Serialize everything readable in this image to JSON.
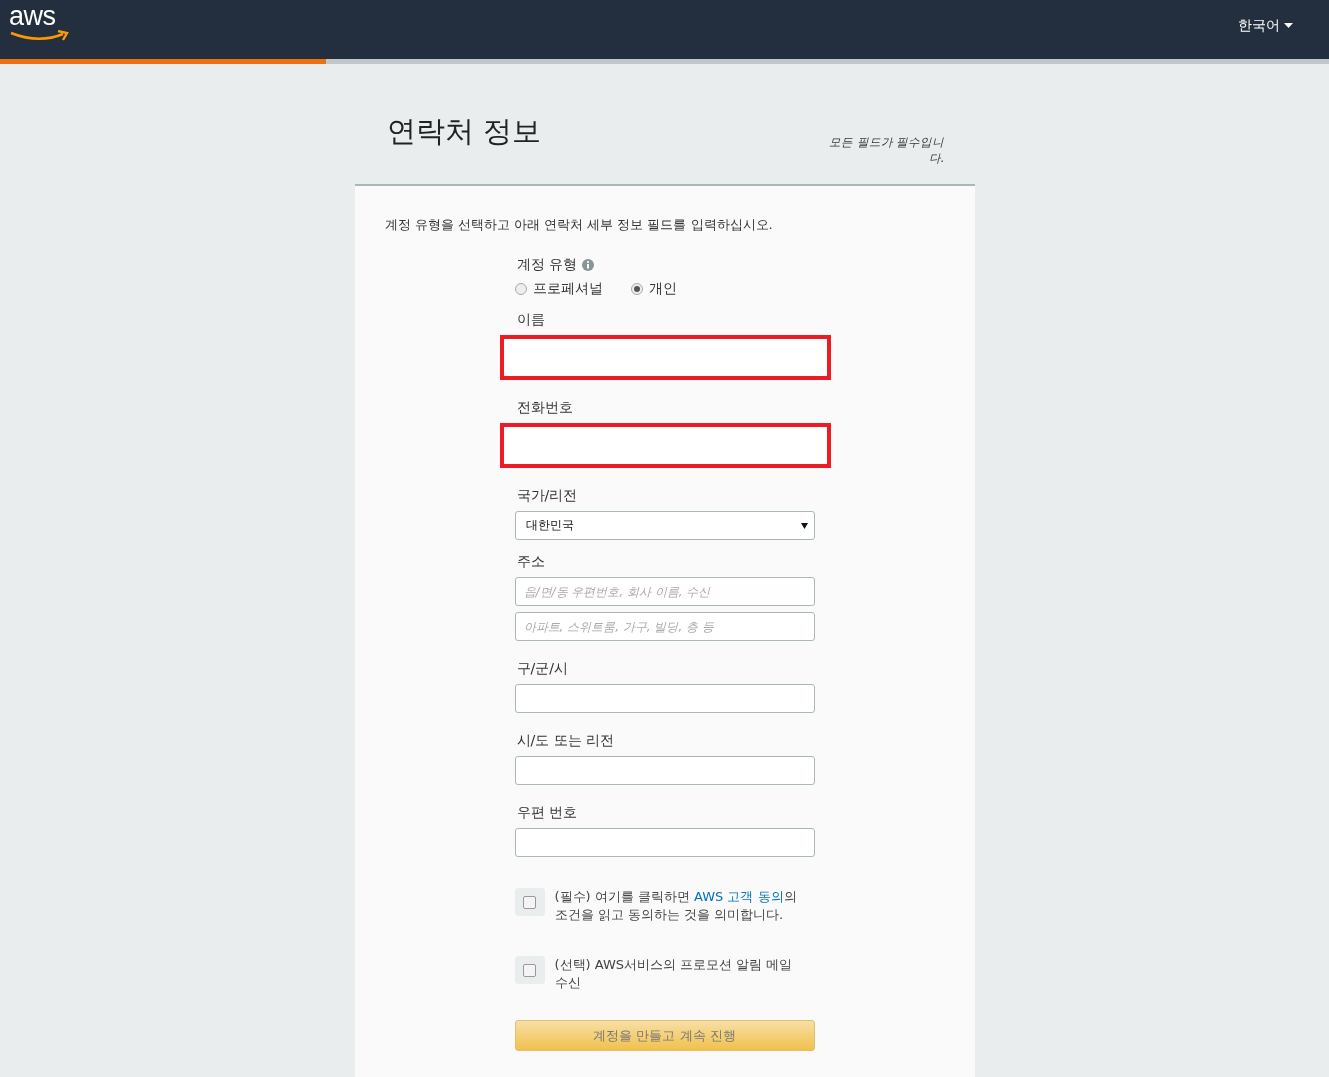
{
  "header": {
    "logo": "aws",
    "language": "한국어",
    "progress": {
      "level": 0.245
    }
  },
  "page": {
    "title": "연락처 정보",
    "required_note": "모든 필드가 필수입니다.",
    "intro": "계정 유형을 선택하고 아래 연락처 세부 정보 필드를 입력하십시오."
  },
  "form": [
    {
      "kind": "radio",
      "label": "계정 유형",
      "options": [
        {
          "label": "프로페셔널",
          "selected": false
        },
        {
          "label": "개인",
          "selected": true
        }
      ]
    },
    {
      "kind": "text",
      "label": "이름",
      "highlighted": true
    },
    {
      "kind": "text",
      "label": "전화번호",
      "highlighted": true
    },
    {
      "kind": "select",
      "label": "국가/리전",
      "value": "대한민국"
    },
    {
      "kind": "address",
      "label": "주소",
      "placeholders": [
        "읍/면/동 우편번호, 회사 이름, 수신",
        "아파트, 스위트룸, 가구, 빌딩, 층 등"
      ]
    },
    {
      "kind": "text",
      "label": "구/군/시",
      "highlighted": false
    },
    {
      "kind": "text",
      "label": "시/도 또는 리전",
      "highlighted": false
    },
    {
      "kind": "text",
      "label": "우편 번호",
      "highlighted": false
    }
  ],
  "agreements": [
    {
      "checked": false,
      "before": "(필수) 여기를 클릭하면 ",
      "link": "AWS 고객 동의",
      "after": "의 조건을 읽고 동의하는 것을 의미합니다."
    },
    {
      "checked": false,
      "before": "(선택) AWS서비스의 프로모션 알림 메일 수신"
    }
  ],
  "submit": "계정을 만들고 계속 진행"
}
